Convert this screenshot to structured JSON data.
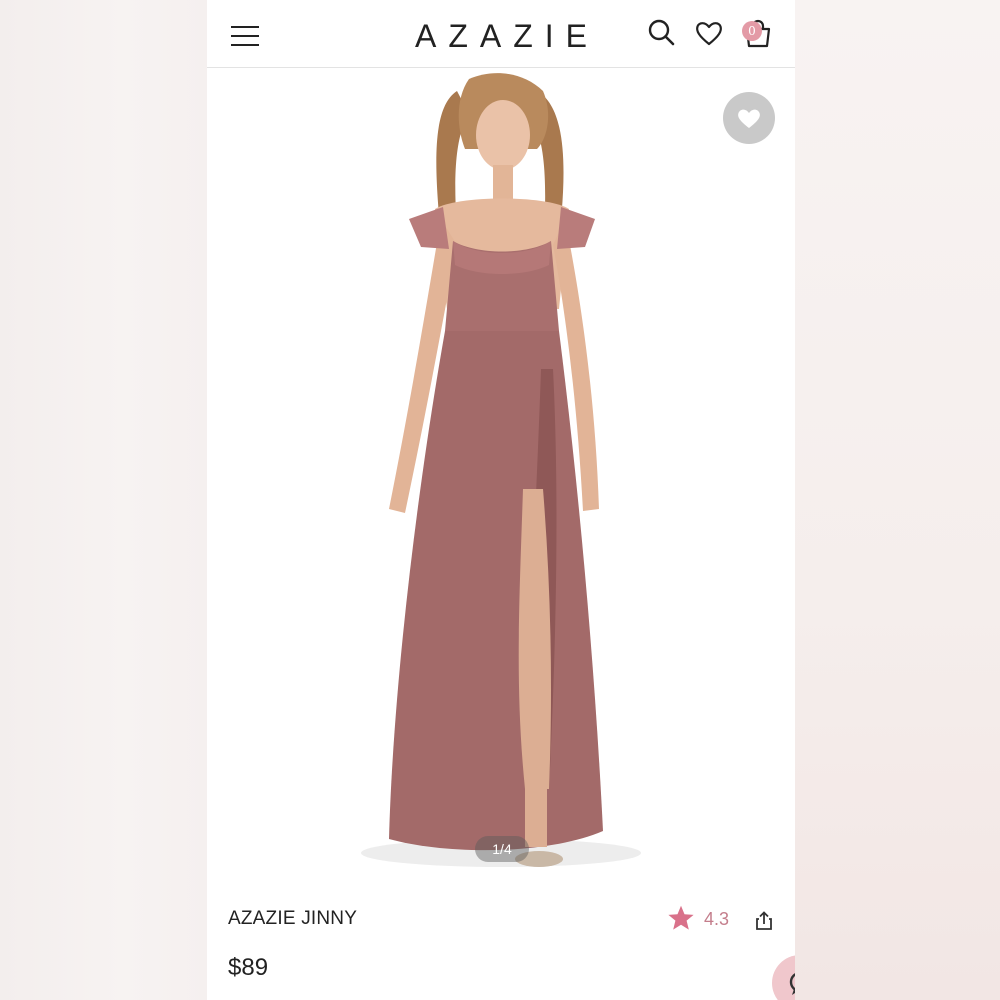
{
  "header": {
    "brand": "AZAZIE",
    "menu_icon": "hamburger-menu-icon",
    "search_icon": "search-icon",
    "wishlist_icon": "heart-icon",
    "bag_icon": "shopping-bag-icon",
    "bag_count": "0"
  },
  "gallery": {
    "pager": "1/4",
    "favorite_icon": "heart-icon"
  },
  "product": {
    "name": "AZAZIE JINNY",
    "rating": "4.3",
    "price": "$89",
    "share_icon": "share-icon"
  },
  "colors": {
    "dress": "#a36a69",
    "rating_accent": "#c47e8c",
    "badge": "#e39aa6",
    "chat_bubble": "#f0c7cc"
  }
}
